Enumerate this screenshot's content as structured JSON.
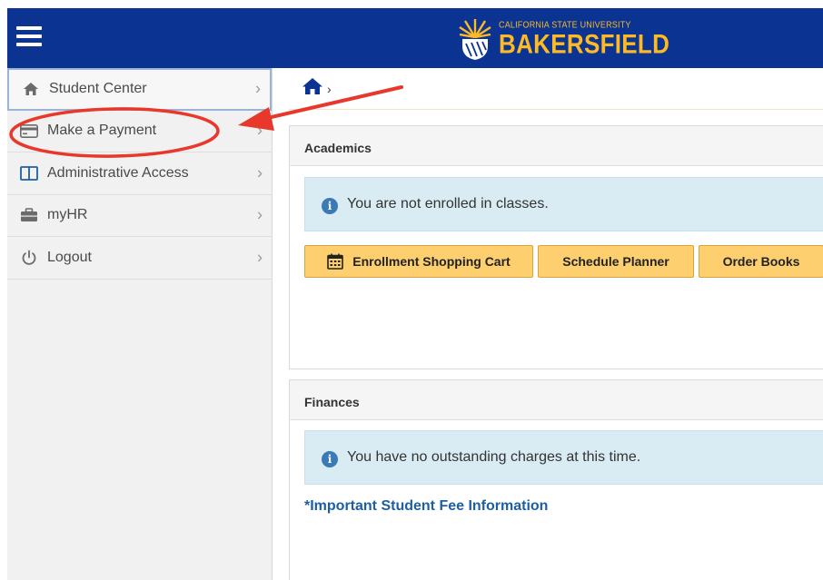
{
  "header": {
    "logo_small": "CALIFORNIA STATE UNIVERSITY",
    "logo_big": "BAKERSFIELD",
    "menu_icon": "hamburger-menu-icon"
  },
  "sidebar": {
    "items": [
      {
        "label": "Student Center",
        "icon": "home-icon"
      },
      {
        "label": "Make a Payment",
        "icon": "credit-card-icon"
      },
      {
        "label": "Administrative Access",
        "icon": "columns-icon"
      },
      {
        "label": "myHR",
        "icon": "briefcase-icon"
      },
      {
        "label": "Logout",
        "icon": "power-icon"
      }
    ],
    "chevron": "›"
  },
  "breadcrumb": {
    "separator": "›",
    "icon": "home-icon"
  },
  "academics": {
    "title": "Academics",
    "alert": "You are not enrolled in classes.",
    "buttons": {
      "cart": "Enrollment Shopping Cart",
      "planner": "Schedule Planner",
      "books": "Order Books"
    }
  },
  "finances": {
    "title": "Finances",
    "alert": "You have no outstanding charges at this time.",
    "link": "*Important Student Fee Information"
  },
  "colors": {
    "header_bg": "#0b3391",
    "accent_gold": "#fdba25",
    "button_bg": "#fdcf6e",
    "annotation_red": "#e8382b"
  }
}
